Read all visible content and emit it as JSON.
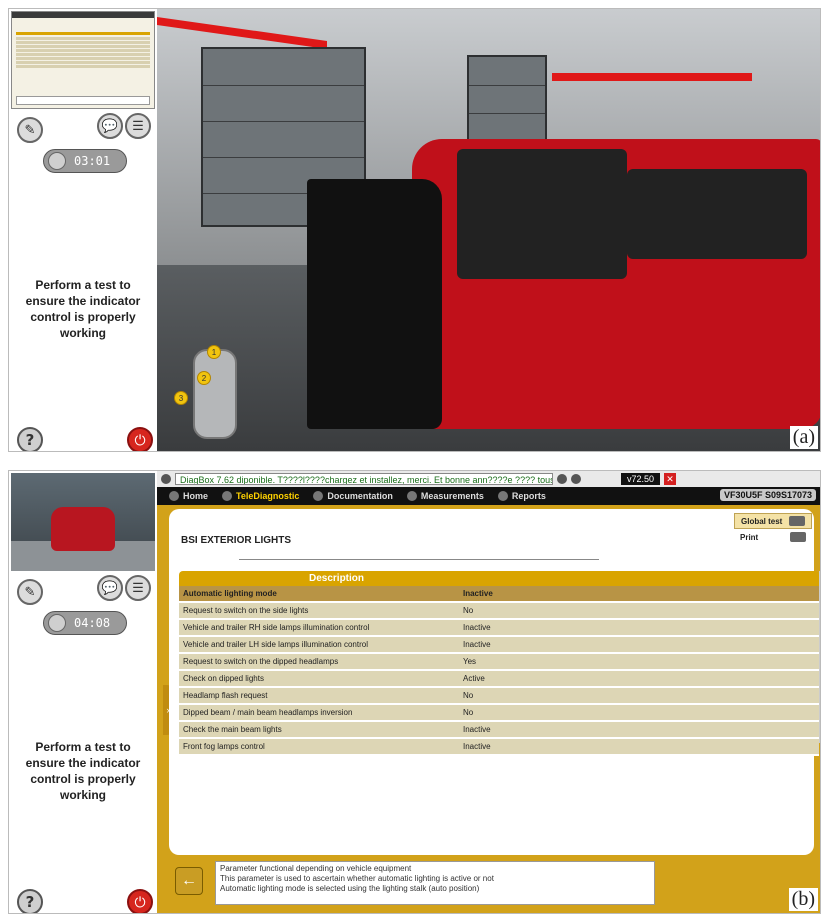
{
  "panel_a": {
    "timer": "03:01",
    "instruction": "Perform a test to ensure the indicator control is properly working",
    "map_markers": [
      "1",
      "2",
      "3"
    ],
    "label": "(a)"
  },
  "panel_b": {
    "timer": "04:08",
    "instruction": "Perform a test to ensure the indicator control is properly working",
    "label": "(b)",
    "diagbox": {
      "update_message": "DiagBox 7.62 diponible. T????l????chargez et installez, merci. Et bonne ann????e ???? tous!",
      "version": "v72.50",
      "tabs": [
        "Home",
        "TeleDiagnostic",
        "Documentation",
        "Measurements",
        "Reports"
      ],
      "vin": "VF30U5F S09S17073",
      "title": "BSI  EXTERIOR LIGHTS",
      "global_test": "Global test",
      "print": "Print",
      "table_header": "Description",
      "rows": [
        {
          "name": "Automatic lighting mode",
          "value": "Inactive"
        },
        {
          "name": "Request to switch on the side lights",
          "value": "No"
        },
        {
          "name": "Vehicle and trailer RH side lamps illumination control",
          "value": "Inactive"
        },
        {
          "name": "Vehicle and trailer LH side lamps illumination control",
          "value": "Inactive"
        },
        {
          "name": "Request to switch on the dipped headlamps",
          "value": "Yes"
        },
        {
          "name": "Check on dipped lights",
          "value": "Active"
        },
        {
          "name": "Headlamp flash request",
          "value": "No"
        },
        {
          "name": "Dipped beam / main beam headlamps inversion",
          "value": "No"
        },
        {
          "name": "Check the main beam lights",
          "value": "Inactive"
        },
        {
          "name": "Front fog lamps control",
          "value": "Inactive"
        }
      ],
      "info_lines": [
        "Parameter functional depending on vehicle equipment",
        "This parameter is used to ascertain whether automatic lighting is active or not",
        "Automatic lighting mode is selected using the lighting stalk (auto position)"
      ]
    }
  }
}
